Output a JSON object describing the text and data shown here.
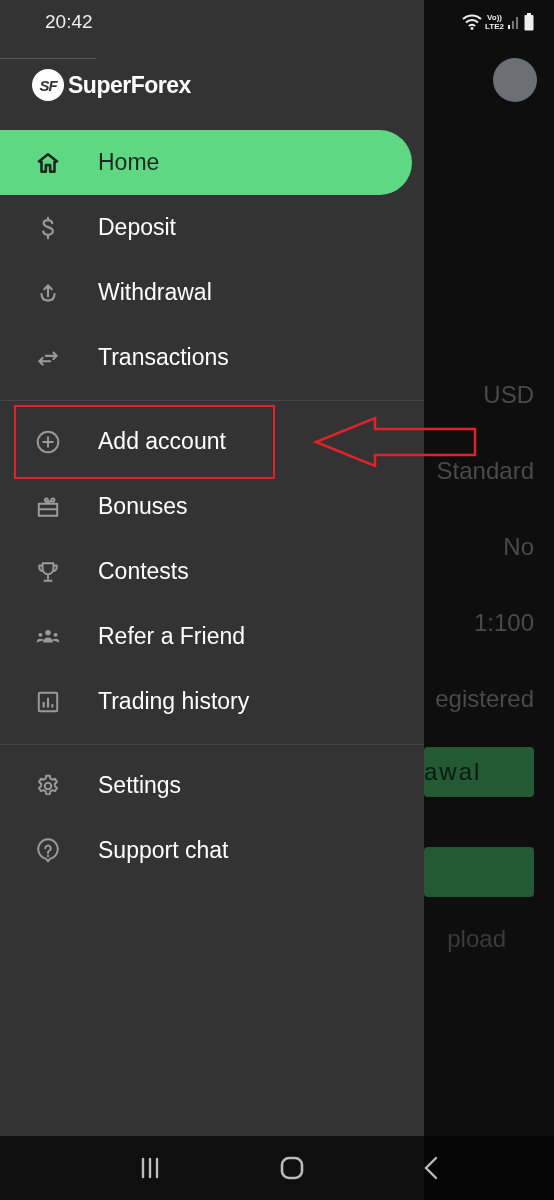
{
  "status_bar": {
    "time": "20:42",
    "volte": "Vo))",
    "network": "LTE2"
  },
  "drawer": {
    "brand": "SuperForex",
    "logo_mark": "SF",
    "groups": [
      [
        {
          "label": "Home",
          "kind": "home",
          "selected": true,
          "highlighted": false
        },
        {
          "label": "Deposit",
          "kind": "dollar",
          "selected": false,
          "highlighted": false
        },
        {
          "label": "Withdrawal",
          "kind": "upload",
          "selected": false,
          "highlighted": false
        },
        {
          "label": "Transactions",
          "kind": "swap",
          "selected": false,
          "highlighted": false
        }
      ],
      [
        {
          "label": "Add account",
          "kind": "plus-circle",
          "selected": false,
          "highlighted": true
        },
        {
          "label": "Bonuses",
          "kind": "gift",
          "selected": false,
          "highlighted": false
        },
        {
          "label": "Contests",
          "kind": "trophy",
          "selected": false,
          "highlighted": false
        },
        {
          "label": "Refer a Friend",
          "kind": "people",
          "selected": false,
          "highlighted": false
        },
        {
          "label": "Trading history",
          "kind": "chart",
          "selected": false,
          "highlighted": false
        }
      ],
      [
        {
          "label": "Settings",
          "kind": "gear",
          "selected": false,
          "highlighted": false
        },
        {
          "label": "Support chat",
          "kind": "help",
          "selected": false,
          "highlighted": false
        }
      ]
    ]
  },
  "background": {
    "values": [
      "USD",
      "Standard",
      "No",
      "1:100",
      "egistered"
    ],
    "button_label": "awal",
    "link": "pload"
  }
}
